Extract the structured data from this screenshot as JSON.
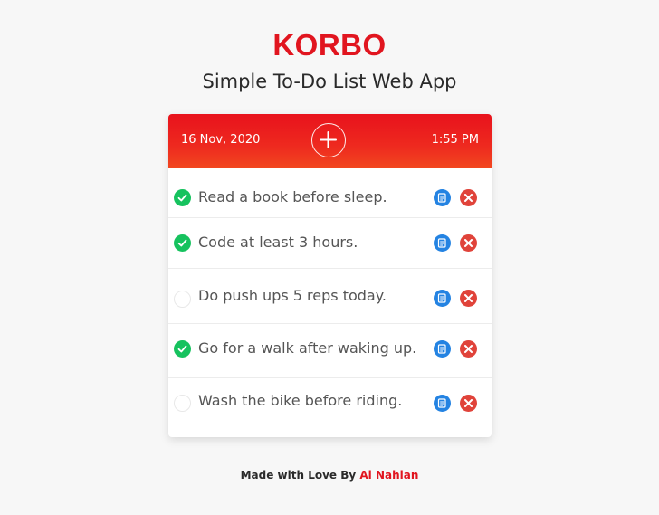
{
  "app": {
    "brand": "KORBO",
    "subtitle": "Simple To-Do List Web App"
  },
  "header": {
    "date": "16 Nov, 2020",
    "time": "1:55 PM",
    "add_icon": "plus-icon"
  },
  "colors": {
    "accent": "#e1151f",
    "header_gradient_start": "#e8121c",
    "header_gradient_end": "#f2471f",
    "done": "#16c25e",
    "edit": "#2483e2",
    "delete": "#e0433a"
  },
  "todos": [
    {
      "text": "Read a book before sleep.",
      "done": true
    },
    {
      "text": "Code at least 3 hours.",
      "done": true
    },
    {
      "text": "Do push ups 5 reps today.",
      "done": false
    },
    {
      "text": "Go for a walk after waking up.",
      "done": true
    },
    {
      "text": "Wash the bike before riding.",
      "done": false
    }
  ],
  "footer": {
    "prefix": "Made with Love By ",
    "author": "Al Nahian"
  }
}
